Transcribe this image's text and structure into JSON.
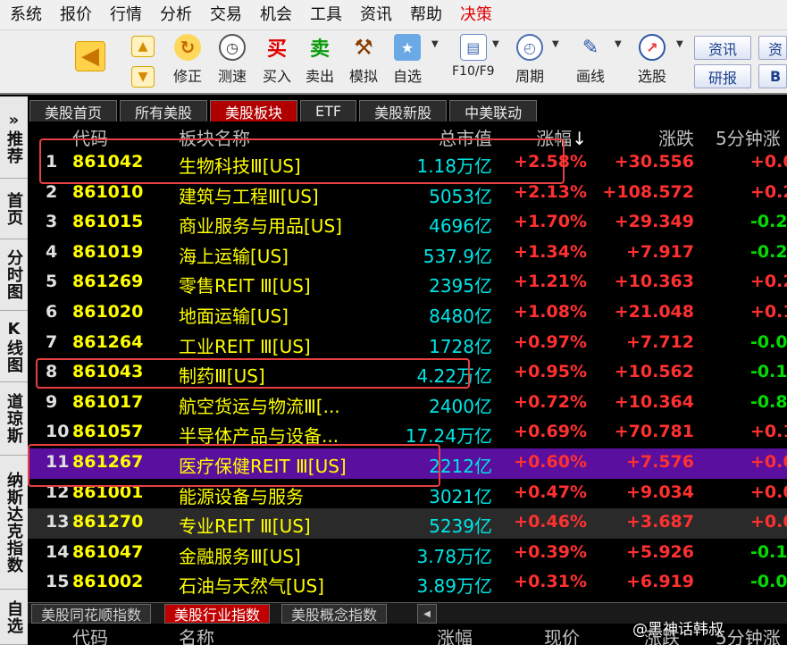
{
  "menu": [
    "系统",
    "报价",
    "行情",
    "分析",
    "交易",
    "机会",
    "工具",
    "资讯",
    "帮助",
    "决策"
  ],
  "toolbar": {
    "buttons": [
      {
        "label": "修正"
      },
      {
        "label": "测速"
      },
      {
        "label": "买入",
        "glyph": "买"
      },
      {
        "label": "卖出",
        "glyph": "卖"
      },
      {
        "label": "模拟"
      },
      {
        "label": "自选"
      },
      {
        "label": "F10/F9"
      },
      {
        "label": "周期"
      },
      {
        "label": "画线"
      },
      {
        "label": "选股"
      }
    ],
    "side_buttons": [
      "资讯",
      "研报"
    ],
    "side_buttons_cut": [
      "资",
      "B"
    ]
  },
  "leftnav": [
    "»推荐",
    "首页",
    "分时图",
    "K线图",
    "道琼斯",
    "纳斯达克指数",
    "自选"
  ],
  "tabs": [
    "美股首页",
    "所有美股",
    "美股板块",
    "ETF",
    "美股新股",
    "中美联动"
  ],
  "active_tab": 2,
  "columns": {
    "code": "代码",
    "name": "板块名称",
    "cap": "总市值",
    "pct": "涨幅",
    "pct_arrow": "↓",
    "chg": "涨跌",
    "m5": "5分钟涨"
  },
  "rows": [
    {
      "idx": "1",
      "code": "861042",
      "name": "生物科技Ⅲ[US]",
      "cap": "1.18万亿",
      "pct": "+2.58%",
      "chg": "+30.556",
      "m5": "+0.0",
      "m5_color": "#ff3030"
    },
    {
      "idx": "2",
      "code": "861010",
      "name": "建筑与工程Ⅲ[US]",
      "cap": "5053亿",
      "pct": "+2.13%",
      "chg": "+108.572",
      "m5": "+0.2",
      "m5_color": "#ff3030"
    },
    {
      "idx": "3",
      "code": "861015",
      "name": "商业服务与用品[US]",
      "cap": "4696亿",
      "pct": "+1.70%",
      "chg": "+29.349",
      "m5": "-0.2",
      "m5_color": "#00dd00"
    },
    {
      "idx": "4",
      "code": "861019",
      "name": "海上运输[US]",
      "cap": "537.9亿",
      "pct": "+1.34%",
      "chg": "+7.917",
      "m5": "-0.2",
      "m5_color": "#00dd00"
    },
    {
      "idx": "5",
      "code": "861269",
      "name": "零售REIT Ⅲ[US]",
      "cap": "2395亿",
      "pct": "+1.21%",
      "chg": "+10.363",
      "m5": "+0.2",
      "m5_color": "#ff3030"
    },
    {
      "idx": "6",
      "code": "861020",
      "name": "地面运输[US]",
      "cap": "8480亿",
      "pct": "+1.08%",
      "chg": "+21.048",
      "m5": "+0.1",
      "m5_color": "#ff3030"
    },
    {
      "idx": "7",
      "code": "861264",
      "name": "工业REIT Ⅲ[US]",
      "cap": "1728亿",
      "pct": "+0.97%",
      "chg": "+7.712",
      "m5": "-0.0",
      "m5_color": "#00dd00"
    },
    {
      "idx": "8",
      "code": "861043",
      "name": "制药Ⅲ[US]",
      "cap": "4.22万亿",
      "pct": "+0.95%",
      "chg": "+10.562",
      "m5": "-0.1",
      "m5_color": "#00dd00"
    },
    {
      "idx": "9",
      "code": "861017",
      "name": "航空货运与物流Ⅲ[...",
      "cap": "2400亿",
      "pct": "+0.72%",
      "chg": "+10.364",
      "m5": "-0.8",
      "m5_color": "#00dd00"
    },
    {
      "idx": "10",
      "code": "861057",
      "name": "半导体产品与设备...",
      "cap": "17.24万亿",
      "pct": "+0.69%",
      "chg": "+70.781",
      "m5": "+0.1",
      "m5_color": "#ff3030"
    },
    {
      "idx": "11",
      "code": "861267",
      "name": "医疗保健REIT Ⅲ[US]",
      "cap": "2212亿",
      "pct": "+0.60%",
      "chg": "+7.576",
      "m5": "+0.0",
      "m5_color": "#ff3030"
    },
    {
      "idx": "12",
      "code": "861001",
      "name": "能源设备与服务",
      "cap": "3021亿",
      "pct": "+0.47%",
      "chg": "+9.034",
      "m5": "+0.0",
      "m5_color": "#ff3030"
    },
    {
      "idx": "13",
      "code": "861270",
      "name": "专业REIT Ⅲ[US]",
      "cap": "5239亿",
      "pct": "+0.46%",
      "chg": "+3.687",
      "m5": "+0.0",
      "m5_color": "#ff3030"
    },
    {
      "idx": "14",
      "code": "861047",
      "name": "金融服务Ⅲ[US]",
      "cap": "3.78万亿",
      "pct": "+0.39%",
      "chg": "+5.926",
      "m5": "-0.1",
      "m5_color": "#00dd00"
    },
    {
      "idx": "15",
      "code": "861002",
      "name": "石油与天然气[US]",
      "cap": "3.89万亿",
      "pct": "+0.31%",
      "chg": "+6.919",
      "m5": "-0.0",
      "m5_color": "#00dd00"
    }
  ],
  "selected_row": 10,
  "sheet_tabs": [
    "美股同花顺指数",
    "美股行业指数",
    "美股概念指数"
  ],
  "active_sheet_tab": 1,
  "bottom_header": {
    "code": "代码",
    "name": "名称",
    "pct": "涨幅",
    "price": "现价",
    "chg": "涨跌",
    "m5": "5分钟涨"
  },
  "watermark": "@黑神话韩叔"
}
